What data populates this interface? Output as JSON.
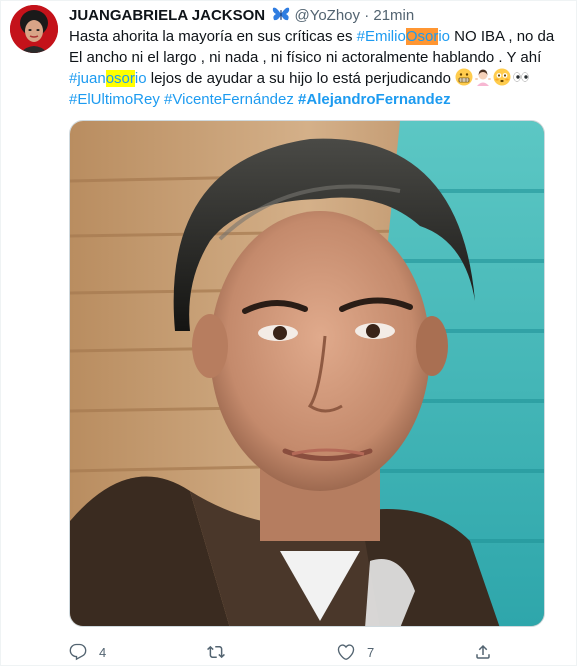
{
  "author": {
    "name": "JUANGABRIELA JACKSON",
    "name_emoji": "butterfly-emoji",
    "handle": "@YoZhoy",
    "separator": "·",
    "timestamp": "21min"
  },
  "tweet": {
    "line1_before": "Hasta ahorita la mayoría en sus críticas es ",
    "hashtag1_prefix": "#Emilio",
    "hashtag1_highlight": "Osor",
    "hashtag1_suffix": "io",
    "line1_after": " NO IBA , no da El ancho ni el largo , ni nada , ni físico ni actoralmente hablando . Y ahí ",
    "hashtag2_prefix": "#juan",
    "hashtag2_highlight": "osor",
    "hashtag2_suffix": "io",
    "line2_after": " lejos de ayudar a su hijo lo está perjudicando ",
    "emojis": [
      "grimacing-face-emoji",
      "woman-shrugging-emoji",
      "flushed-face-emoji",
      "eyes-emoji"
    ],
    "hashtags_line": [
      {
        "text": "#ElUltimoRey",
        "bold": false
      },
      {
        "text": "#VicenteFernández",
        "bold": false
      },
      {
        "text": "#AlejandroFernandez",
        "bold": true
      }
    ]
  },
  "media": {
    "icon": "portrait-photo",
    "colors": {
      "wood": "#c9a47a",
      "teal": "#3fb6b8",
      "hair": "#2a2622",
      "skin": "#c89478",
      "jacket": "#3a2b20"
    }
  },
  "actions": {
    "reply_count": "4",
    "retweet_count": "",
    "like_count": "7",
    "share_count": ""
  },
  "colors": {
    "link": "#1d9bf0",
    "muted": "#536471",
    "highlight_orange": "#ff9632",
    "highlight_yellow": "#ffff00",
    "avatar_bg": "#c4121a"
  }
}
